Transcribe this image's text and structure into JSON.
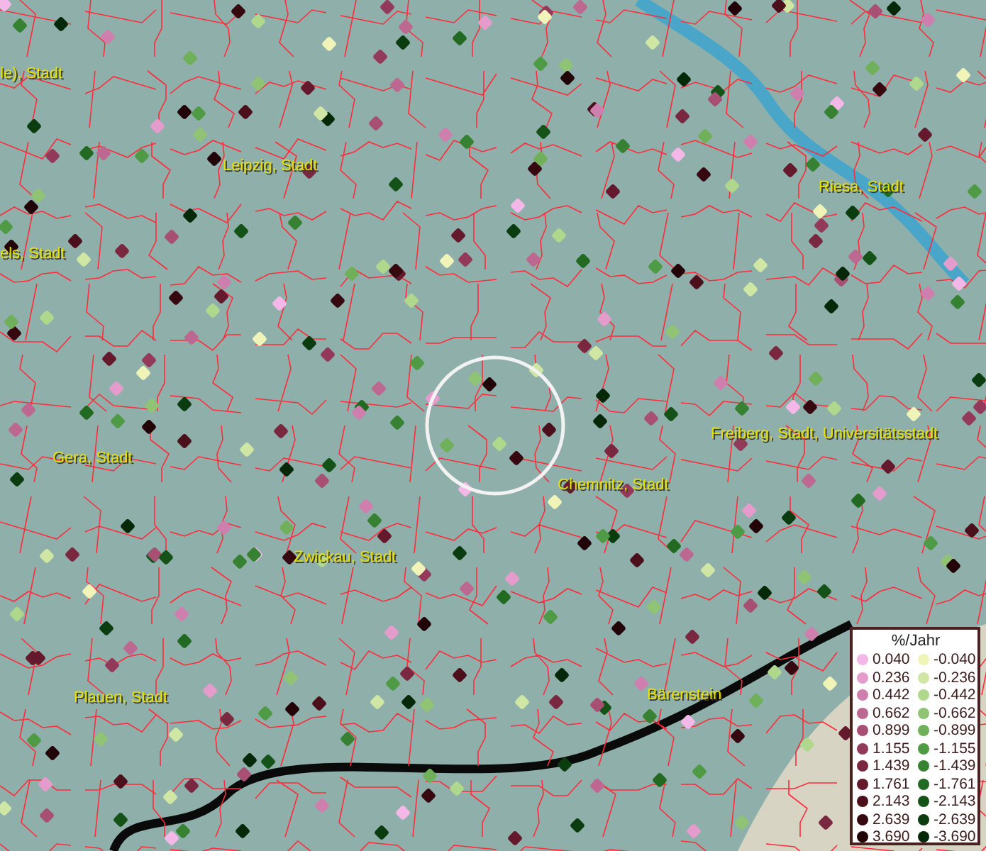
{
  "map": {
    "places": [
      {
        "name": "le), Stadt"
      },
      {
        "name": "Leipzig, Stadt"
      },
      {
        "name": "els, Stadt"
      },
      {
        "name": "Riesa, Stadt"
      },
      {
        "name": "Gera, Stadt"
      },
      {
        "name": "Freiberg, Stadt, Universitätsstadt"
      },
      {
        "name": "Chemnitz, Stadt"
      },
      {
        "name": "Zwickau, Stadt"
      },
      {
        "name": "Plauen, Stadt"
      },
      {
        "name": "Bärenstein"
      }
    ]
  },
  "legend": {
    "title": "%/Jahr",
    "rows": [
      {
        "positive": {
          "label": "0.040",
          "color": "#f4b8e8"
        },
        "negative": {
          "label": "-0.040",
          "color": "#f0f4b8"
        }
      },
      {
        "positive": {
          "label": "0.236",
          "color": "#e49ccc"
        },
        "negative": {
          "label": "-0.236",
          "color": "#cfe6a4"
        }
      },
      {
        "positive": {
          "label": "0.442",
          "color": "#cf7fae"
        },
        "negative": {
          "label": "-0.442",
          "color": "#b0d88c"
        }
      },
      {
        "positive": {
          "label": "0.662",
          "color": "#bd6890"
        },
        "negative": {
          "label": "-0.662",
          "color": "#90c474"
        }
      },
      {
        "positive": {
          "label": "0.899",
          "color": "#a84f74"
        },
        "negative": {
          "label": "-0.899",
          "color": "#70b05a"
        }
      },
      {
        "positive": {
          "label": "1.155",
          "color": "#933a5a"
        },
        "negative": {
          "label": "-1.155",
          "color": "#4f9a44"
        }
      },
      {
        "positive": {
          "label": "1.439",
          "color": "#7a2840"
        },
        "negative": {
          "label": "-1.439",
          "color": "#368232"
        }
      },
      {
        "positive": {
          "label": "1.761",
          "color": "#641a2c"
        },
        "negative": {
          "label": "-1.761",
          "color": "#226a22"
        }
      },
      {
        "positive": {
          "label": "2.143",
          "color": "#4c101c"
        },
        "negative": {
          "label": "-2.143",
          "color": "#145218"
        }
      },
      {
        "positive": {
          "label": "2.639",
          "color": "#360810"
        },
        "negative": {
          "label": "-2.639",
          "color": "#0a3c10"
        }
      },
      {
        "positive": {
          "label": "3.690",
          "color": "#220408"
        },
        "negative": {
          "label": "-3.690",
          "color": "#042808"
        }
      }
    ]
  }
}
